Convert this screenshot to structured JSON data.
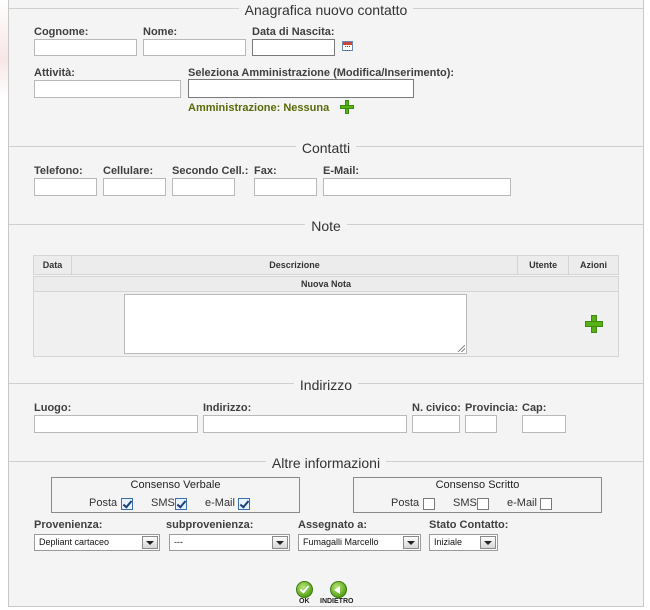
{
  "sections": {
    "anagrafica": "Anagrafica nuovo contatto",
    "contatti": "Contatti",
    "note": "Note",
    "indirizzo": "Indirizzo",
    "altre": "Altre informazioni"
  },
  "anagrafica": {
    "cognome_label": "Cognome:",
    "nome_label": "Nome:",
    "data_nascita_label": "Data di Nascita:",
    "attivita_label": "Attività:",
    "amministrazione_label": "Seleziona Amministrazione (Modifica/Inserimento):",
    "amministrazione_status": "Amministrazione: Nessuna",
    "cognome_value": "",
    "nome_value": "",
    "data_nascita_value": "",
    "attivita_value": "",
    "amministrazione_value": ""
  },
  "contatti": {
    "telefono_label": "Telefono:",
    "cellulare_label": "Cellulare:",
    "secondo_cell_label": "Secondo Cell.:",
    "fax_label": "Fax:",
    "email_label": "E-Mail:"
  },
  "note": {
    "columns": [
      "Data",
      "Descrizione",
      "Utente",
      "Azioni"
    ],
    "nuova_nota": "Nuova Nota",
    "textarea_value": ""
  },
  "indirizzo": {
    "luogo_label": "Luogo:",
    "indirizzo_label": "Indirizzo:",
    "civico_label": "N. civico:",
    "provincia_label": "Provincia:",
    "cap_label": "Cap:"
  },
  "altre": {
    "consenso_verbale": {
      "title": "Consenso Verbale",
      "posta": "Posta",
      "sms": "SMS",
      "email": "e-Mail",
      "posta_checked": true,
      "sms_checked": true,
      "email_checked": true
    },
    "consenso_scritto": {
      "title": "Consenso Scritto",
      "posta": "Posta",
      "sms": "SMS",
      "email": "e-Mail",
      "posta_checked": false,
      "sms_checked": false,
      "email_checked": false
    },
    "provenienza_label": "Provenienza:",
    "provenienza_value": "Depliant cartaceo",
    "subprovenienza_label": "subprovenienza:",
    "subprovenienza_value": "---",
    "assegnato_label": "Assegnato a:",
    "assegnato_value": "Fumagalli Marcello",
    "stato_label": "Stato Contatto:",
    "stato_value": "Iniziale"
  },
  "buttons": {
    "ok": "OK",
    "indietro": "INDIETRO"
  },
  "colors": {
    "accent_green": "#58b116",
    "label_green": "#5a6a08",
    "panel_bg": "#f4f4f4"
  },
  "icons": [
    "calendar-icon",
    "add-icon",
    "checkbox",
    "ok-icon",
    "back-icon"
  ]
}
